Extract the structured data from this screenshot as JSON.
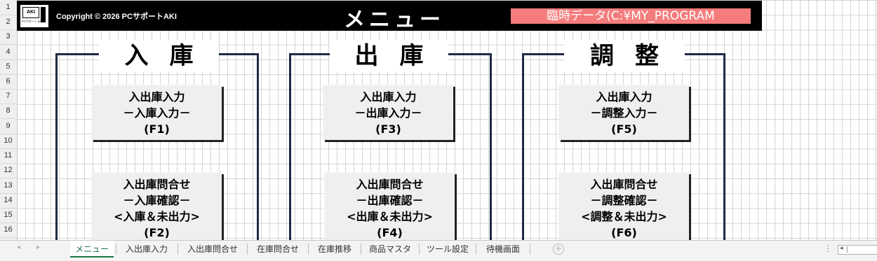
{
  "header": {
    "copyright": "Copyright © 2026 PCサポートAKI",
    "title": "メニュー",
    "data_source": "臨時データ(C:¥MY_PROGRAM",
    "logo_text": "AKI",
    "logo_subtext": "PCサポート AKI"
  },
  "row_numbers": [
    "1",
    "2",
    "3",
    "4",
    "5",
    "6",
    "7",
    "8",
    "9",
    "10",
    "11",
    "12",
    "13",
    "14",
    "15",
    "16"
  ],
  "sections": [
    {
      "title": "入庫",
      "buttons": [
        {
          "lines": [
            "入出庫入力",
            "－入庫入力－",
            "(F1)"
          ]
        },
        {
          "lines": [
            "入出庫問合せ",
            "－入庫確認－",
            "<入庫＆未出力>",
            "(F2)"
          ]
        }
      ]
    },
    {
      "title": "出庫",
      "buttons": [
        {
          "lines": [
            "入出庫入力",
            "－出庫入力－",
            "(F3)"
          ]
        },
        {
          "lines": [
            "入出庫問合せ",
            "－出庫確認－",
            "<出庫＆未出力>",
            "(F4)"
          ]
        }
      ]
    },
    {
      "title": "調整",
      "buttons": [
        {
          "lines": [
            "入出庫入力",
            "－調整入力－",
            "(F5)"
          ]
        },
        {
          "lines": [
            "入出庫問合せ",
            "－調整確認－",
            "<調整＆未出力>",
            "(F6)"
          ]
        }
      ]
    }
  ],
  "tabs": [
    "メニュー",
    "入出庫入力",
    "入出庫問合せ",
    "在庫問合せ",
    "在庫推移",
    "商品マスタ",
    "ツール設定",
    "待機画面"
  ],
  "active_tab": "メニュー",
  "colors": {
    "header_bg": "#000000",
    "data_badge": "#f47c7c",
    "frame": "#1f2a44",
    "active_tab": "#1e7145"
  },
  "icons": {
    "tab_prev": "◂",
    "tab_next": "▸",
    "add_sheet": "+",
    "more": "⋮",
    "scroll_left": "◂"
  }
}
